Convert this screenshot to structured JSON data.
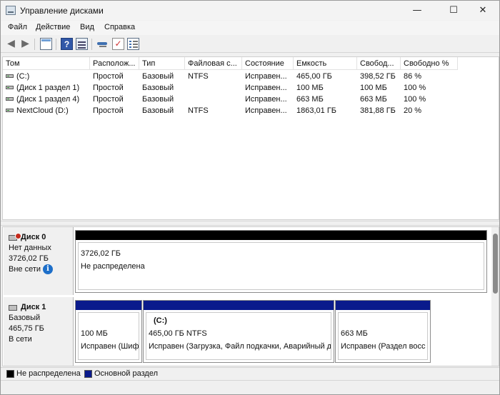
{
  "window": {
    "title": "Управление дисками",
    "min": "—",
    "max": "☐",
    "close": "✕"
  },
  "menu": [
    "Файл",
    "Действие",
    "Вид",
    "Справка"
  ],
  "toolbar": {
    "back": "◀",
    "forward": "▶",
    "help": "?",
    "check": "✓"
  },
  "volumes": {
    "headers": [
      "Том",
      "Располож...",
      "Тип",
      "Файловая с...",
      "Состояние",
      "Емкость",
      "Свобод...",
      "Свободно %"
    ],
    "rows": [
      [
        "(C:)",
        "Простой",
        "Базовый",
        "NTFS",
        "Исправен...",
        "465,00 ГБ",
        "398,52 ГБ",
        "86 %"
      ],
      [
        "(Диск 1 раздел 1)",
        "Простой",
        "Базовый",
        "",
        "Исправен...",
        "100 МБ",
        "100 МБ",
        "100 %"
      ],
      [
        "(Диск 1 раздел 4)",
        "Простой",
        "Базовый",
        "",
        "Исправен...",
        "663 МБ",
        "663 МБ",
        "100 %"
      ],
      [
        "NextCloud (D:)",
        "Простой",
        "Базовый",
        "NTFS",
        "Исправен...",
        "1863,01 ГБ",
        "381,88 ГБ",
        "20 %"
      ]
    ]
  },
  "disks": [
    {
      "name": "Диск 0",
      "type": "Нет данных",
      "size": "3726,02 ГБ",
      "status": "Вне сети",
      "info": "i",
      "partitions": [
        {
          "label": "",
          "size": "3726,02 ГБ",
          "status": "Не распределена",
          "color": "#000000"
        }
      ]
    },
    {
      "name": "Диск 1",
      "type": "Базовый",
      "size": "465,75 ГБ",
      "status": "В сети",
      "partitions": [
        {
          "label": "",
          "size": "100 МБ",
          "status": "Исправен (Шиф",
          "color": "#0a1a8c"
        },
        {
          "label": "(C:)",
          "size": "465,00 ГБ NTFS",
          "status": "Исправен (Загрузка, Файл подкачки, Аварийный д",
          "color": "#0a1a8c"
        },
        {
          "label": "",
          "size": "663 МБ",
          "status": "Исправен (Раздел восс",
          "color": "#0a1a8c"
        }
      ]
    }
  ],
  "legend": [
    {
      "label": "Не распределена",
      "color": "#000000"
    },
    {
      "label": "Основной раздел",
      "color": "#0a1a8c"
    }
  ]
}
